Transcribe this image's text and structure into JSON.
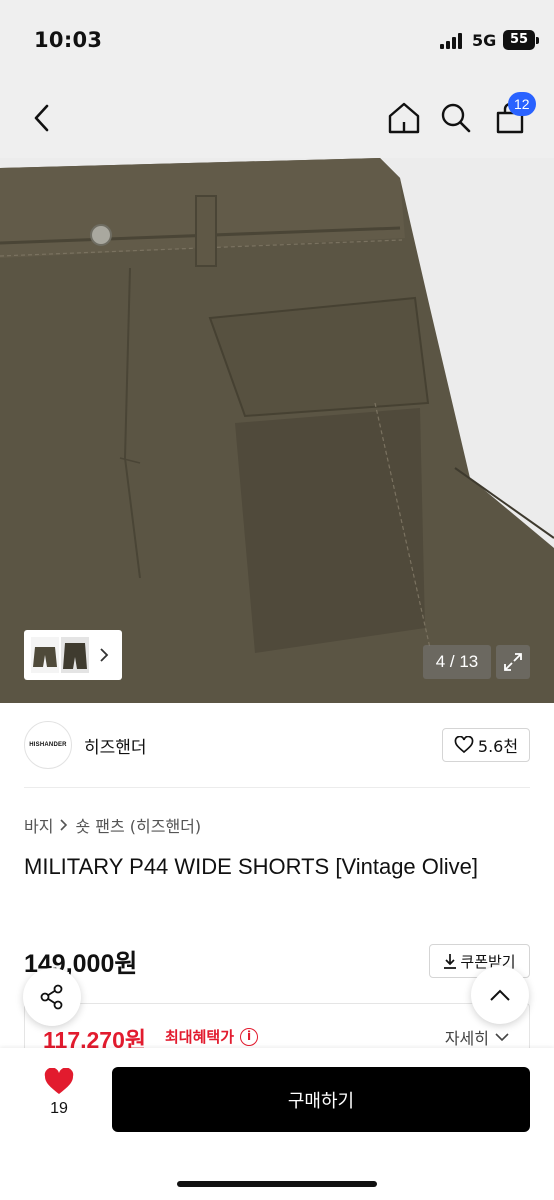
{
  "status_bar": {
    "time": "10:03",
    "network": "5G",
    "battery": "55"
  },
  "nav": {
    "cart_count": "12"
  },
  "gallery": {
    "counter": "4 / 13"
  },
  "brand": {
    "logo_text": "HISHANDER",
    "name": "히즈핸더",
    "likes": "5.6천"
  },
  "breadcrumb": [
    "바지",
    "숏 팬츠 (히즈핸더)"
  ],
  "product": {
    "title": "MILITARY P44 WIDE SHORTS [Vintage Olive]",
    "original_price": "149,000원",
    "coupon_label": "쿠폰받기",
    "sale_price": "117,270원",
    "max_benefit_label": "최대혜택가",
    "detail_label": "자세히"
  },
  "bottom_bar": {
    "wish_count": "19",
    "buy_label": "구매하기"
  },
  "colors": {
    "accent_red": "#e21b2e",
    "badge_blue": "#2962ff",
    "olive": "#5b5544"
  }
}
